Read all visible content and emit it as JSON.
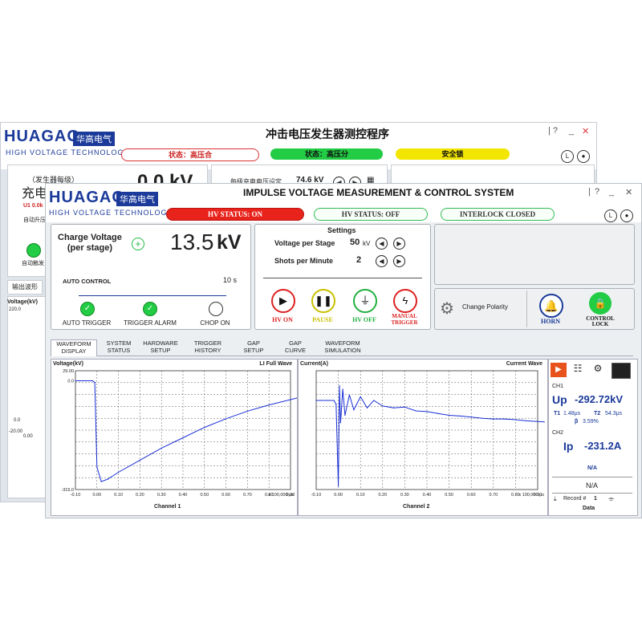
{
  "back_window": {
    "logo": "HUAGAO",
    "logo_cn": "华高电气",
    "subtitle": "HIGH  VOLTAGE  TECHNOLOGY",
    "title": "冲击电压发生器测控程序",
    "status1": "状态：高压合",
    "status2": "状态：高压分",
    "status3": "安全锁",
    "label_stage": "（发生器每级）",
    "label_charge": "充电电压",
    "value": "0.0 kV",
    "u1": "U1 0.0k",
    "auto": "自动升压",
    "setting_label": "每级充电电压设定",
    "setting_value": "74.6 kV",
    "auto_trigger": "自动触发",
    "tab_output": "输出波形",
    "voltage_label": "Voltage(kV)",
    "y_top": "220.0",
    "y_zero": "0.0",
    "y_min": "-20.00",
    "x_first": "0.00"
  },
  "front_window": {
    "logo": "HUAGAO",
    "logo_cn": "华高电气",
    "subtitle": "HIGH  VOLTAGE  TECHNOLOGY",
    "title": "IMPULSE VOLTAGE MEASUREMENT & CONTROL SYSTEM",
    "window_controls": [
      "|",
      "?",
      "_",
      "✕"
    ],
    "status_hv_on": "HV STATUS: ON",
    "status_hv_off": "HV STATUS: OFF",
    "status_interlock": "INTERLOCK CLOSED",
    "colors": {
      "hv_on": "#e8231c",
      "green": "#22cc44",
      "accent": "#1b3a9a"
    }
  },
  "charge": {
    "label": "Charge Voltage\n(per stage)",
    "value": "13.5",
    "unit": "kV",
    "auto_control": "AUTO CONTROL",
    "time": "10 s",
    "auto_trigger": "AUTO TRIGGER",
    "trigger_alarm": "TRIGGER ALARM",
    "chop_on": "CHOP ON"
  },
  "settings": {
    "title": "Settings",
    "vps_label": "Voltage per Stage",
    "vps_value": "50",
    "vps_unit": "kV",
    "spm_label": "Shots per Minute",
    "spm_value": "2",
    "hv_on": "HV ON",
    "pause": "PAUSE",
    "hv_off": "HV OFF",
    "manual_trigger": "MANUAL\nTRIGGER"
  },
  "controls": {
    "change_polarity": "Change Polarity",
    "horn": "HORN",
    "control_lock": "CONTROL\nLOCK"
  },
  "tabs": [
    "WAVEFORM\nDISPLAY",
    "SYSTEM\nSTATUS",
    "HARDWARE\nSETUP",
    "TRIGGER\nHISTORY",
    "GAP\nSETUP",
    "GAP\nCURVE",
    "WAVEFORM\nSIMULATION"
  ],
  "plot1": {
    "ylabel": "Voltage(kV)",
    "title": "LI Full Wave",
    "y_ticks": [
      "29.00",
      "0.0",
      "-315.0"
    ],
    "x_ticks": [
      "-0.10",
      "0.00",
      "0.10",
      "0.20",
      "0.30",
      "0.40",
      "0.50",
      "0.60",
      "0.70",
      "0.80",
      "0.90"
    ],
    "x_unit": "x 100,000 μs",
    "channel": "Channel 1"
  },
  "plot2": {
    "ylabel": "Current(A)",
    "title": "Current Wave",
    "x_ticks": [
      "-0.10",
      "0.00",
      "0.10",
      "0.20",
      "0.30",
      "0.40",
      "0.50",
      "0.60",
      "0.70",
      "0.80",
      "0.90"
    ],
    "x_unit": "x 100,000 μs",
    "channel": "Channel 2"
  },
  "side": {
    "ch1": "CH1",
    "up_label": "Up",
    "up_value": "-292.72kV",
    "t1_label": "T1",
    "t1_value": "1.48μs",
    "t2_label": "T2",
    "t2_value": "54.3μs",
    "beta_label": "β",
    "beta_value": "3.59%",
    "ch2": "CH2",
    "ip_label": "Ip",
    "ip_value": "-231.2A",
    "na1": "N/A",
    "na2": "N/A",
    "record_label": "Record #",
    "record_value": "1",
    "data": "Data"
  },
  "chart_data": [
    {
      "type": "line",
      "title": "LI Full Wave",
      "ylabel": "Voltage(kV)",
      "xlabel": "Channel 1",
      "x_unit": "x 100,000 μs",
      "xlim": [
        -0.1,
        0.9
      ],
      "ylim": [
        -315.0,
        29.0
      ],
      "series": [
        {
          "x": [
            -0.1,
            -0.02,
            -0.01,
            0.0,
            0.02,
            0.05,
            0.1,
            0.2,
            0.3,
            0.4,
            0.5,
            0.6,
            0.7,
            0.8,
            0.93
          ],
          "y": [
            0.0,
            0.0,
            -5.0,
            -250.0,
            -292.0,
            -285.0,
            -265.0,
            -230.0,
            -195.0,
            -165.0,
            -135.0,
            -110.0,
            -88.0,
            -70.0,
            -50.0
          ]
        }
      ]
    },
    {
      "type": "line",
      "title": "Current Wave",
      "ylabel": "Current(A)",
      "xlabel": "Channel 2",
      "x_unit": "x 100,000 μs",
      "xlim": [
        -0.1,
        0.9
      ],
      "ylim": [
        -240,
        80
      ],
      "series": [
        {
          "x": [
            -0.1,
            -0.05,
            -0.02,
            -0.01,
            0.0,
            0.005,
            0.01,
            0.02,
            0.03,
            0.05,
            0.07,
            0.1,
            0.13,
            0.16,
            0.2,
            0.25,
            0.3,
            0.35,
            0.4,
            0.45,
            0.5,
            0.55,
            0.6,
            0.65,
            0.7,
            0.75,
            0.8,
            0.85,
            0.93
          ],
          "y": [
            0,
            0,
            0,
            -10,
            -231,
            40,
            -60,
            30,
            -40,
            15,
            -25,
            10,
            -20,
            0,
            -15,
            -20,
            -18,
            -28,
            -30,
            -35,
            -40,
            -42,
            -45,
            -48,
            -50,
            -50,
            -52,
            -55,
            -58
          ]
        }
      ]
    }
  ]
}
